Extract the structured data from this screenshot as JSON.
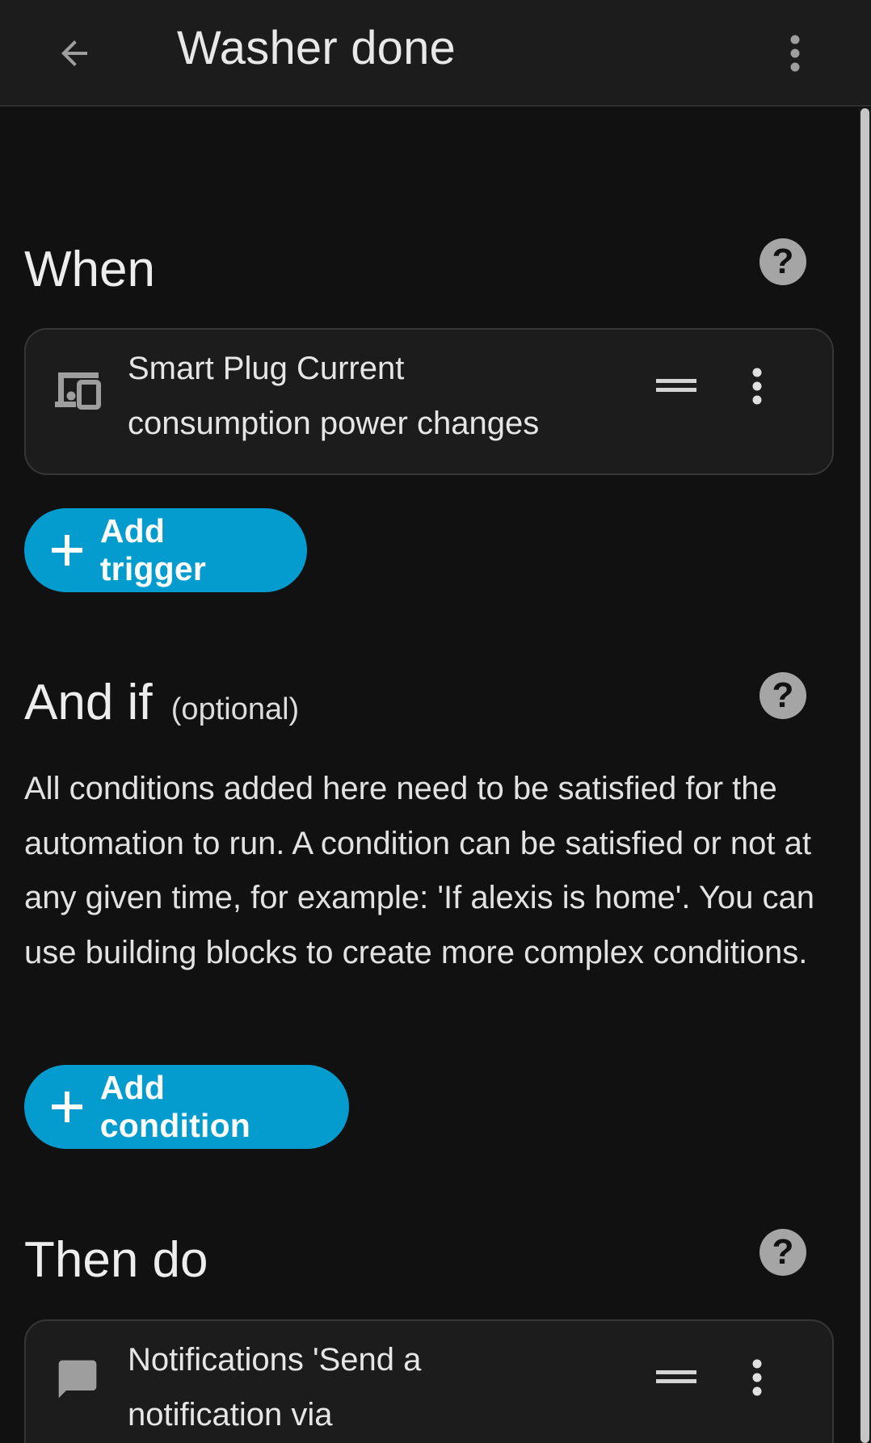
{
  "header": {
    "title": "Washer done",
    "back_icon": "arrow-left-icon",
    "menu_icon": "dots-vertical-icon"
  },
  "when": {
    "title": "When",
    "help_icon": "help-circle-icon",
    "trigger": {
      "icon": "devices-icon",
      "text": "Smart Plug Current consumption power changes"
    },
    "add_label": "Add trigger"
  },
  "and_if": {
    "title": "And if",
    "optional_label": "(optional)",
    "help_icon": "help-circle-icon",
    "description": "All conditions added here need to be satisfied for the automation to run. A condition can be satisfied or not at any given time, for example: 'If alexis is home'. You can use building blocks to create more complex conditions.",
    "add_label": "Add condition"
  },
  "then_do": {
    "title": "Then do",
    "help_icon": "help-circle-icon",
    "action": {
      "icon": "message-icon",
      "text": "Notifications 'Send a notification via"
    }
  },
  "colors": {
    "background": "#111111",
    "header": "#1c1c1c",
    "card": "#1c1c1c",
    "accent": "#049cce",
    "help_icon": "#a5a5a5"
  }
}
